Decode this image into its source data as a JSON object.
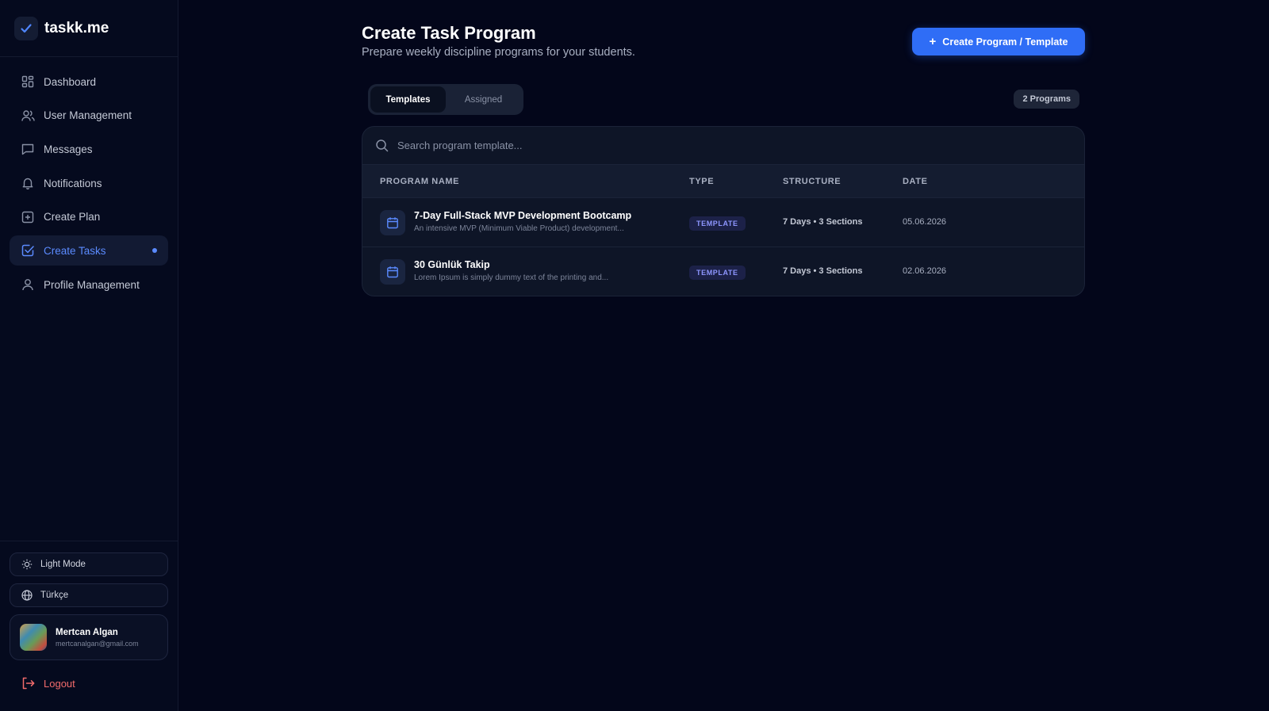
{
  "brand": {
    "name": "taskk.me",
    "logo_icon": "check-icon"
  },
  "sidebar": {
    "items": [
      {
        "label": "Dashboard",
        "icon": "grid-icon"
      },
      {
        "label": "User Management",
        "icon": "users-icon"
      },
      {
        "label": "Messages",
        "icon": "message-icon"
      },
      {
        "label": "Notifications",
        "icon": "bell-icon"
      },
      {
        "label": "Create Plan",
        "icon": "plus-square-icon"
      },
      {
        "label": "Create Tasks",
        "icon": "check-square-icon",
        "active": true
      },
      {
        "label": "Profile Management",
        "icon": "user-icon"
      }
    ],
    "theme_toggle": "Light Mode",
    "language": "Türkçe",
    "user": {
      "name": "Mertcan Algan",
      "email": "mertcanalgan@gmail.com"
    },
    "logout": "Logout"
  },
  "header": {
    "title": "Create Task Program",
    "subtitle": "Prepare weekly discipline programs for your students.",
    "create_button": "Create Program / Template"
  },
  "tabs": [
    {
      "label": "Templates",
      "active": true
    },
    {
      "label": "Assigned",
      "active": false
    }
  ],
  "program_count": "2 Programs",
  "search": {
    "placeholder": "Search program template..."
  },
  "table": {
    "columns": [
      "PROGRAM NAME",
      "TYPE",
      "STRUCTURE",
      "DATE"
    ],
    "rows": [
      {
        "title": "7-Day Full-Stack MVP Development Bootcamp",
        "description": "An intensive MVP (Minimum Viable Product) development...",
        "type": "TEMPLATE",
        "structure": "7 Days • 3 Sections",
        "date": "05.06.2026"
      },
      {
        "title": "30 Günlük Takip",
        "description": "Lorem Ipsum is simply dummy text of the printing and...",
        "type": "TEMPLATE",
        "structure": "7 Days • 3 Sections",
        "date": "02.06.2026"
      }
    ]
  },
  "colors": {
    "background": "#03061a",
    "accent": "#2f6df6",
    "active_nav": "#5b8bff",
    "logout": "#f26b6b",
    "template_badge": "#8e96ff"
  }
}
